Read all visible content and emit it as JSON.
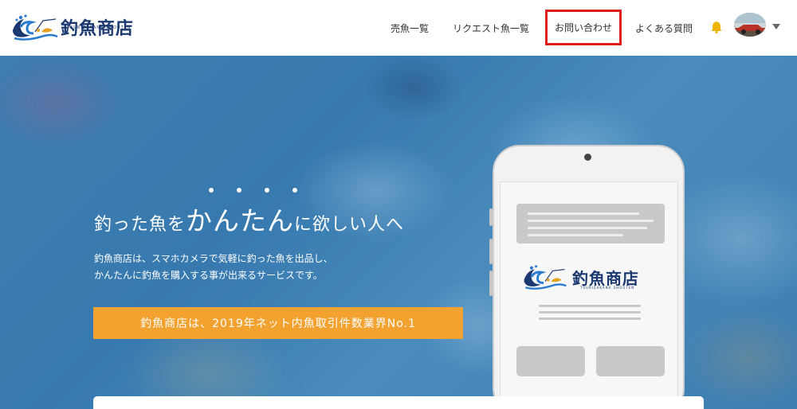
{
  "header": {
    "logo_text": "釣魚商店",
    "logo_sub": "TSURIZAKANA SHOUTEN",
    "nav": [
      {
        "label": "売魚一覧"
      },
      {
        "label": "リクエスト魚一覧"
      },
      {
        "label": "お問い合わせ"
      },
      {
        "label": "よくある質問"
      }
    ],
    "icons": [
      "bell-icon",
      "avatar",
      "caret-down-icon"
    ],
    "highlight_color": "#e21c1c"
  },
  "hero": {
    "headline_prefix": "釣った魚を",
    "headline_emphasis": "かんたん",
    "headline_suffix": "に欲しい人へ",
    "description_line1": "釣魚商店は、スマホカメラで気軽に釣った魚を出品し、",
    "description_line2": "かんたんに釣魚を購入する事が出来るサービスです。",
    "cta_label": "釣魚商店は、2019年ネット内魚取引件数業界No.1",
    "cta_color": "#f3a12f"
  },
  "phone_mockup": {
    "logo_text": "釣魚商店",
    "logo_sub": "TSURIZAKANA SHOUTEN"
  }
}
